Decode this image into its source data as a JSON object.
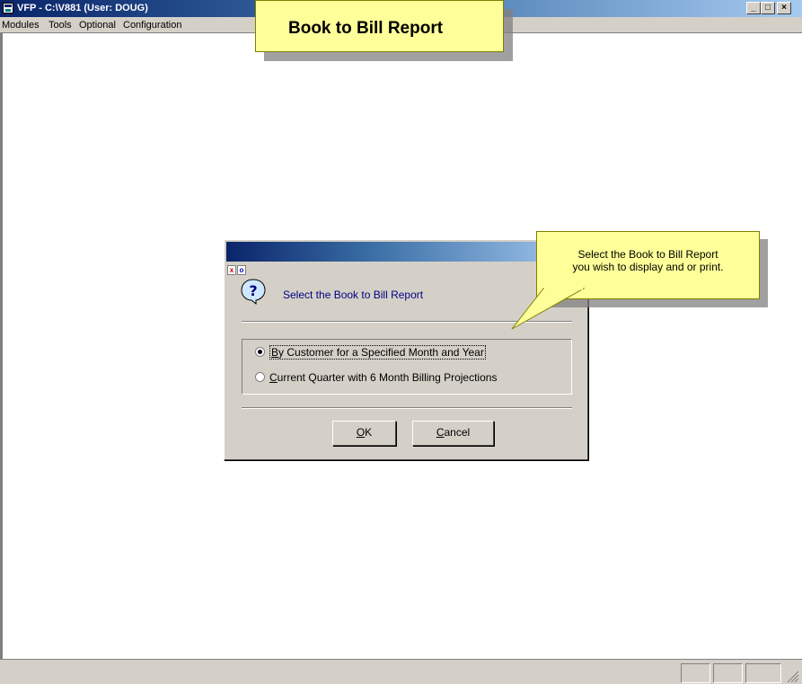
{
  "window": {
    "title": "VFP - C:\\V881  (User: DOUG)",
    "minimize_label": "_",
    "maximize_label": "□",
    "close_label": "×"
  },
  "menubar": {
    "items": [
      {
        "label": "Modules"
      },
      {
        "label": "Tools"
      },
      {
        "label": "Optional"
      },
      {
        "label": "Configuration"
      }
    ]
  },
  "header_callout": {
    "text": "Book to Bill Report"
  },
  "tip_callout": {
    "line1": "Select the Book to Bill Report",
    "line2": "you wish to display and or print."
  },
  "dialog": {
    "ctrl_close": "x",
    "ctrl_restore": "o",
    "icon": "question-icon",
    "prompt": "Select the Book to Bill Report",
    "options": [
      {
        "mnemonic": "B",
        "rest": "y Customer for a Specified Month and Year",
        "selected": true
      },
      {
        "mnemonic": "C",
        "rest": "urrent Quarter with 6 Month Billing Projections",
        "selected": false
      }
    ],
    "ok_button": {
      "mnemonic": "O",
      "rest": "K"
    },
    "cancel_button": {
      "mnemonic": "C",
      "rest": "ancel"
    }
  },
  "colors": {
    "title_active": "#0a246a",
    "callout_bg": "#ffff99",
    "dialog_bg": "#d4d0c8",
    "prompt_text": "#000080"
  }
}
